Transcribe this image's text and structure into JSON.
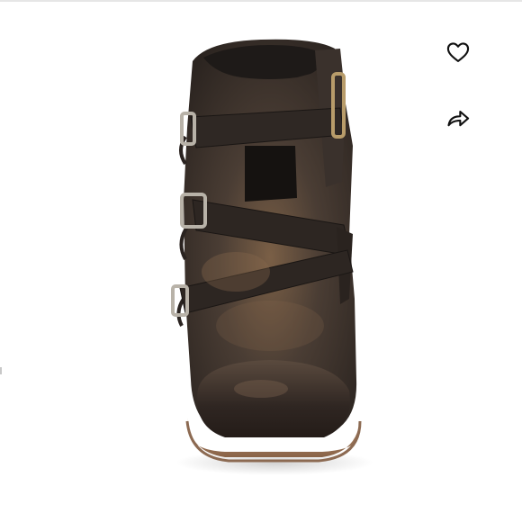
{
  "product_image": {
    "alt": "",
    "leather_color": "#3a302a",
    "highlight_color": "#8a6a4c",
    "sole_color": "#a0765a",
    "buckle_color": "#b8b2a8"
  },
  "actions": {
    "like_icon": "heart-outline-icon",
    "share_icon": "share-arrow-icon"
  }
}
